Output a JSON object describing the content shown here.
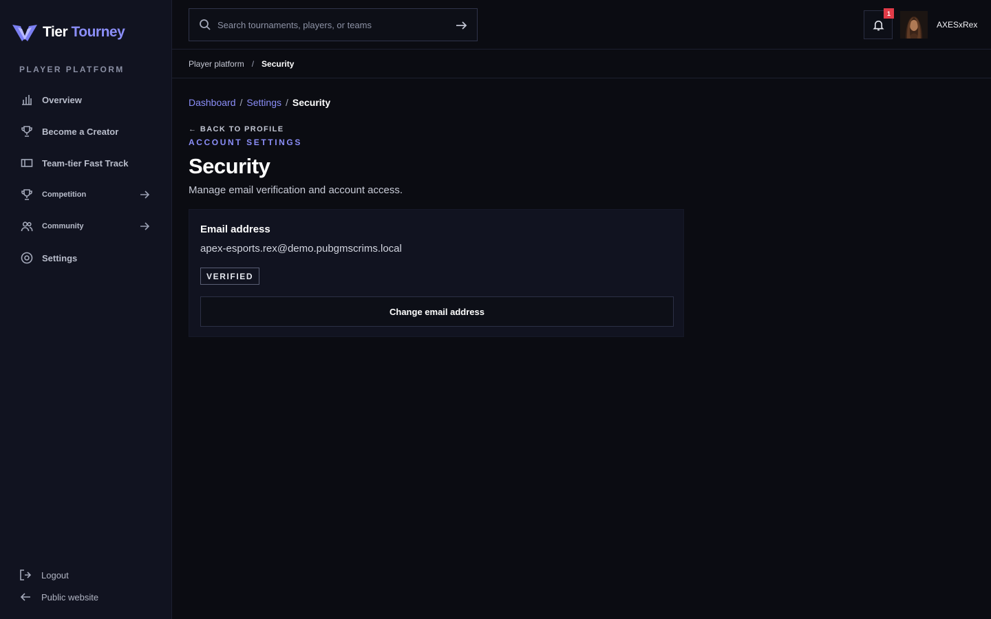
{
  "brand": {
    "name_part1": "Tier",
    "name_part2": "Tourney",
    "accent": "#8b8ef8"
  },
  "sidebar": {
    "section_label": "PLAYER PLATFORM",
    "items": [
      {
        "label": "Overview",
        "icon": "bar-chart-icon"
      },
      {
        "label": "Become a Creator",
        "icon": "trophy-icon"
      },
      {
        "label": "Team-tier Fast Track",
        "icon": "ticket-icon"
      },
      {
        "label": "Competition",
        "icon": "trophy-icon"
      },
      {
        "label": "Community",
        "icon": "users-icon"
      },
      {
        "label": "Settings",
        "icon": "gear-icon"
      }
    ],
    "logout_label": "Logout",
    "public_label": "Public website"
  },
  "topbar": {
    "search_placeholder": "Search tournaments, players, or teams",
    "notification_count": "1",
    "username": "AXESxRex"
  },
  "subbar": {
    "root": "Player platform",
    "separator": "/",
    "current": "Security"
  },
  "main": {
    "breadcrumbs": [
      "Dashboard",
      "Settings",
      "Security"
    ],
    "separator": "/",
    "back_label": "← BACK TO PROFILE",
    "eyebrow": "ACCOUNT SETTINGS",
    "title": "Security",
    "subtitle": "Manage email verification and account access.",
    "email_card": {
      "title": "Email address",
      "email": "apex-esports.rex@demo.pubgmscrims.local",
      "status": "VERIFIED",
      "button_label": "Change email address"
    }
  },
  "colors": {
    "background": "#0b0c12",
    "sidebar": "#111320",
    "badge": "#e03b48"
  }
}
